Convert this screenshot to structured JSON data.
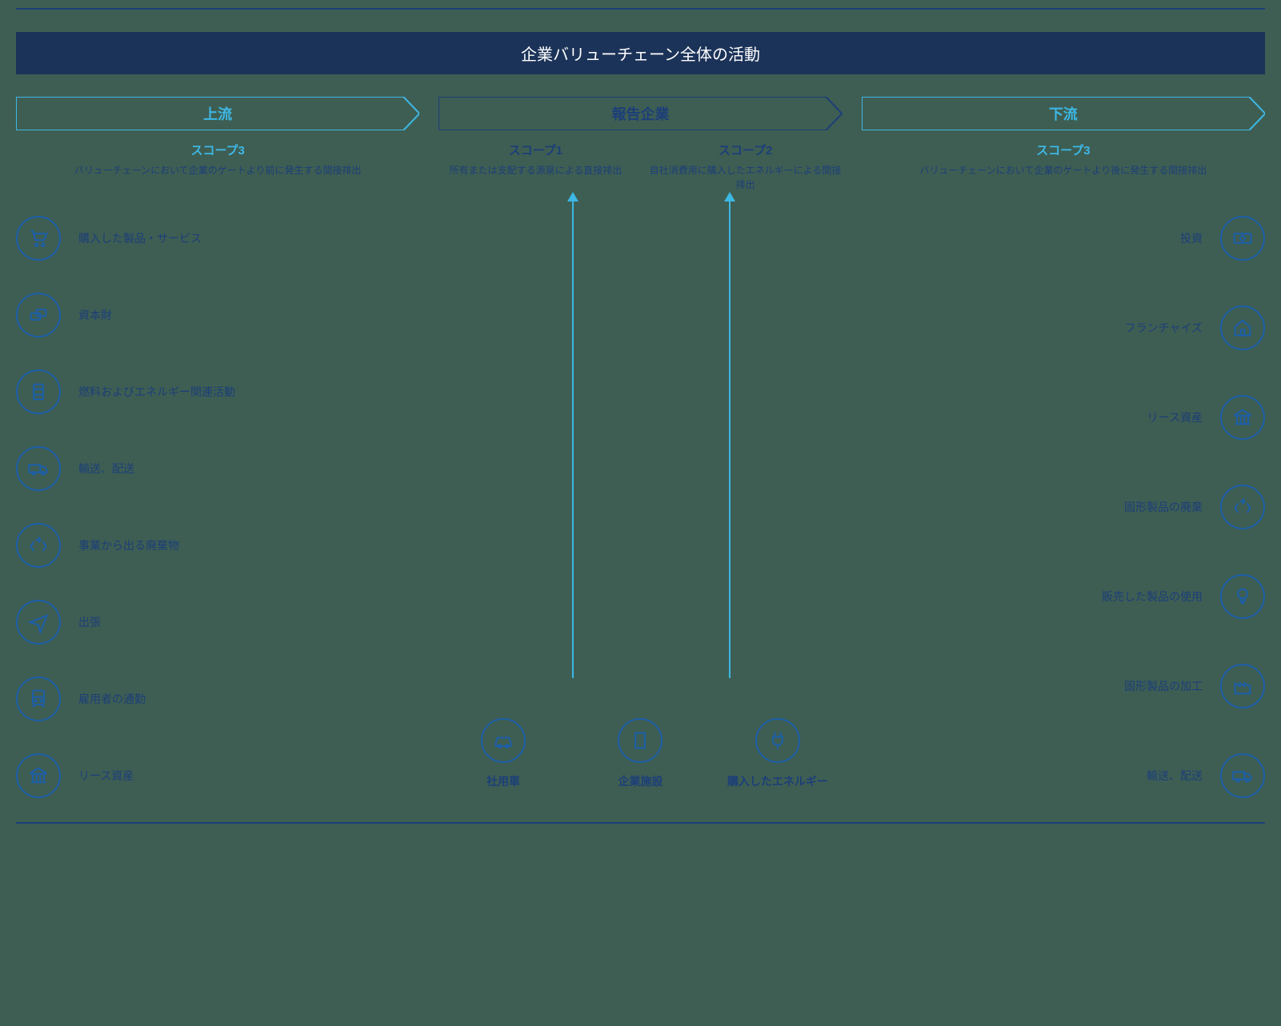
{
  "title": "企業バリューチェーン全体の活動",
  "streams": {
    "upstream": "上流",
    "reporting": "報告企業",
    "downstream": "下流"
  },
  "scopes": {
    "scope3_upstream": {
      "title": "スコープ3",
      "desc": "バリューチェーンにおいて企業のゲートより前に発生する間接排出"
    },
    "scope1": {
      "title": "スコープ1",
      "desc": "所有または支配する源泉による直接排出"
    },
    "scope2": {
      "title": "スコープ2",
      "desc": "自社消費用に購入したエネルギーによる間接排出"
    },
    "scope3_downstream": {
      "title": "スコープ3",
      "desc": "バリューチェーンにおいて企業のゲートより後に発生する間接排出"
    }
  },
  "upstream_items": [
    "購入した製品・サービス",
    "資本財",
    "燃料およびエネルギー関連活動",
    "輸送、配送",
    "事業から出る廃棄物",
    "出張",
    "雇用者の通勤",
    "リース資産"
  ],
  "middle_items": {
    "vehicles": "社用車",
    "facilities": "企業施設",
    "energy": "購入したエネルギー"
  },
  "downstream_items": [
    "投資",
    "フランチャイズ",
    "リース資産",
    "固形製品の廃棄",
    "販売した製品の使用",
    "固形製品の加工",
    "輸送、配送"
  ]
}
